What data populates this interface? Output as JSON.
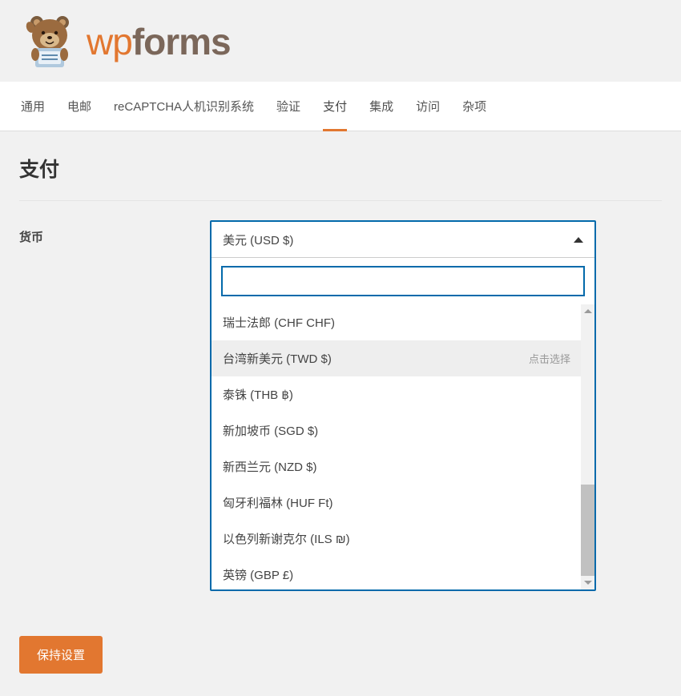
{
  "brand": {
    "wp": "wp",
    "forms": "forms"
  },
  "tabs": {
    "items": [
      {
        "label": "通用"
      },
      {
        "label": "电邮"
      },
      {
        "label": "reCAPTCHA人机识别系统"
      },
      {
        "label": "验证"
      },
      {
        "label": "支付"
      },
      {
        "label": "集成"
      },
      {
        "label": "访问"
      },
      {
        "label": "杂项"
      }
    ]
  },
  "page": {
    "title": "支付"
  },
  "field": {
    "label": "货币",
    "selected": "美元 (USD $)",
    "hover_hint": "点击选择",
    "options": [
      "瑞士法郎 (CHF CHF)",
      "台湾新美元 (TWD $)",
      "泰铢 (THB ฿)",
      "新加坡币 (SGD $)",
      "新西兰元 (NZD $)",
      "匈牙利福林 (HUF Ft)",
      "以色列新谢克尔 (ILS ₪)",
      "英镑 (GBP £)"
    ]
  },
  "buttons": {
    "save": "保持设置"
  }
}
